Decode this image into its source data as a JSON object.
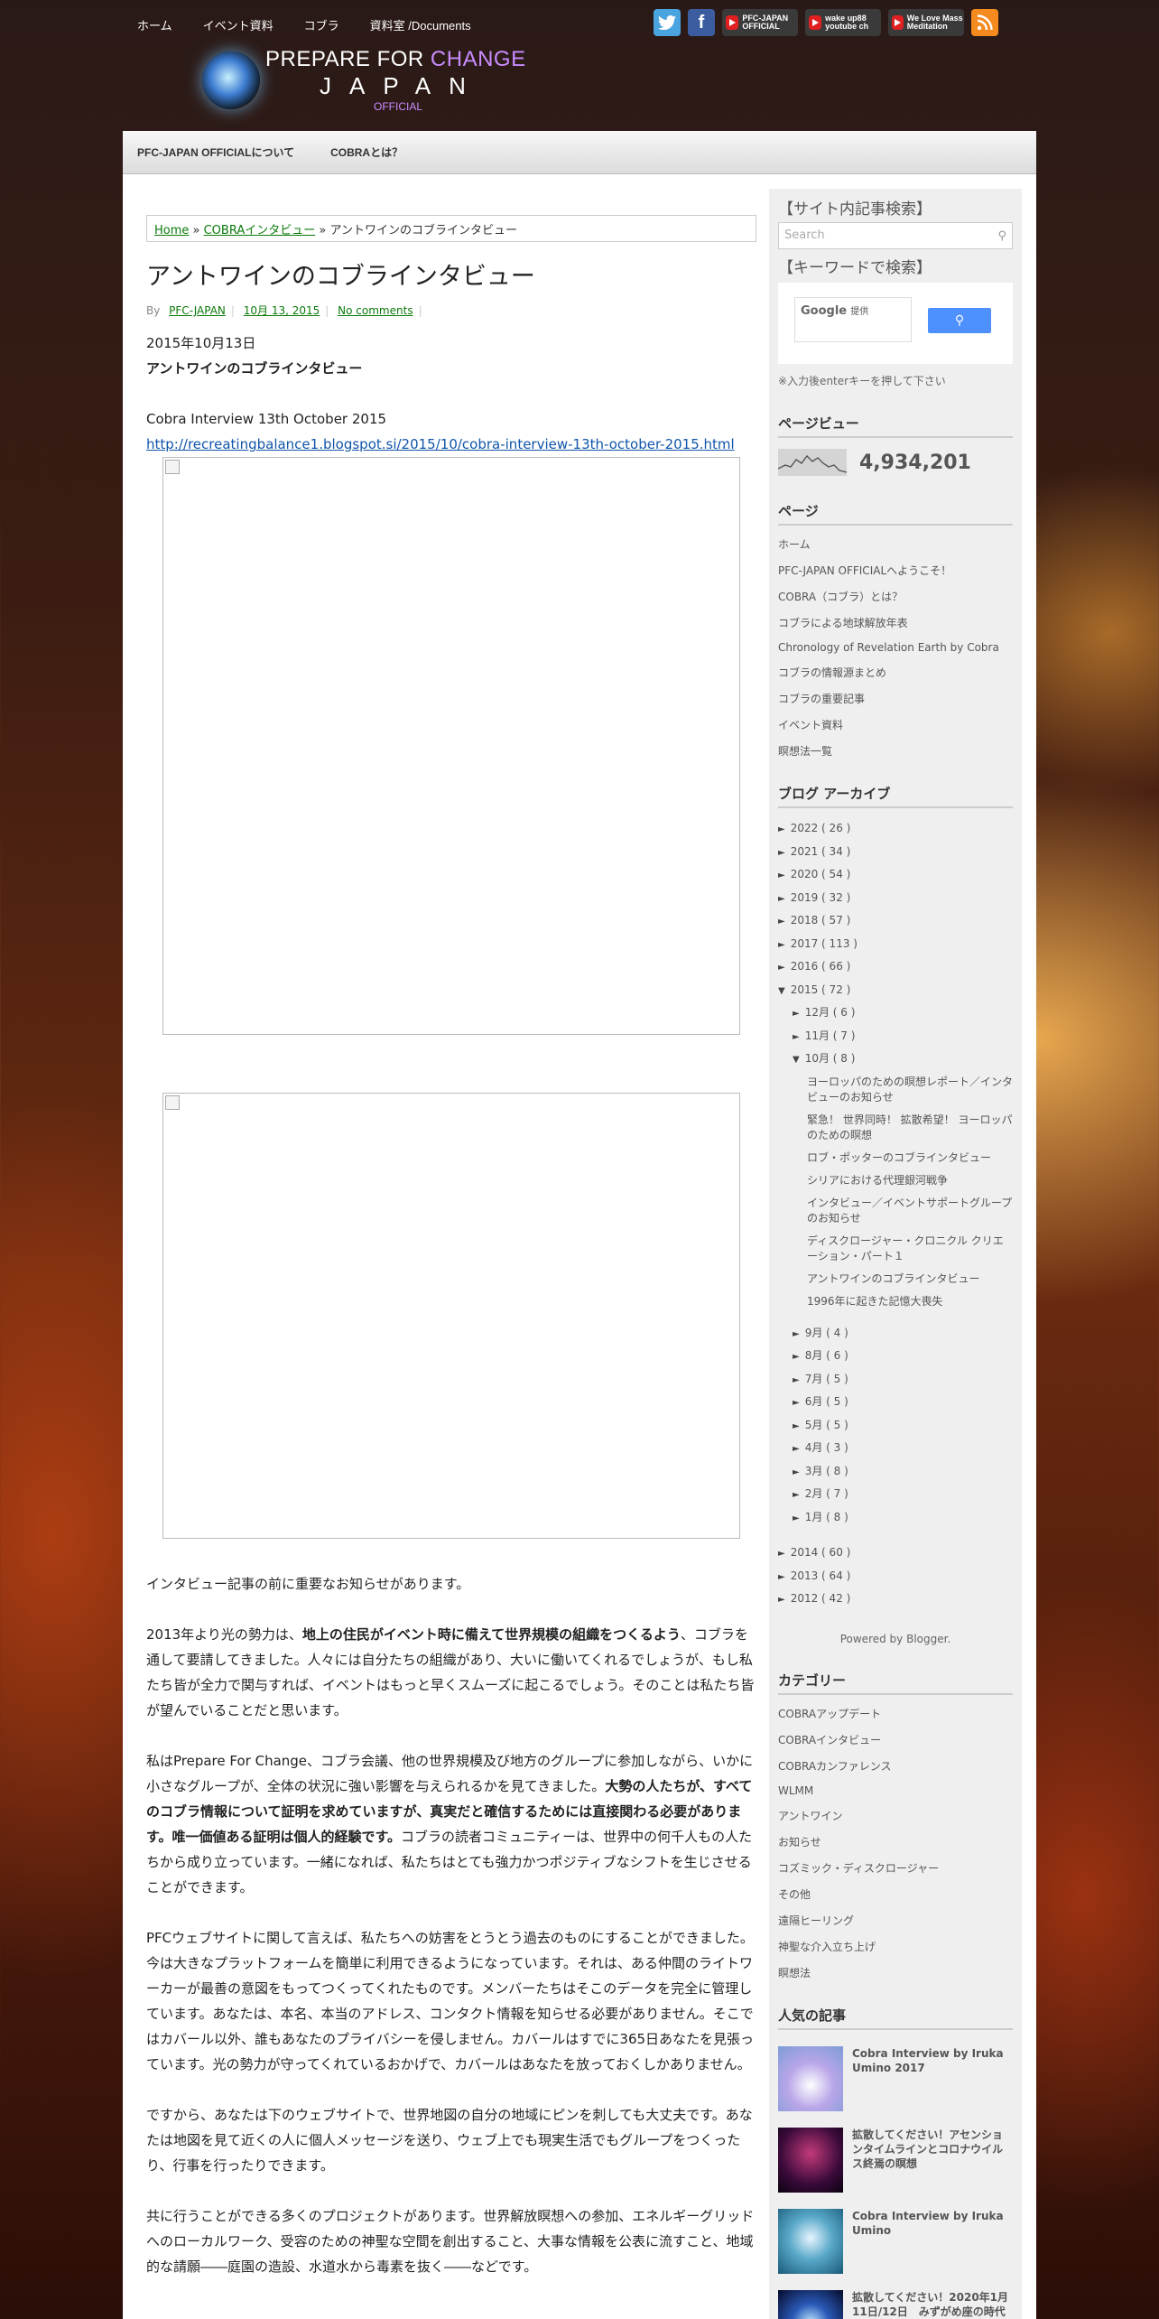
{
  "topnav": [
    "ホーム",
    "イベント資料",
    "コブラ",
    "資料室 /Documents"
  ],
  "social": {
    "twitter_icon": "twitter-icon",
    "facebook_icon": "facebook-icon",
    "yt1": "PFC-JAPAN OFFICIAL",
    "yt2": "wake up88 youtube ch",
    "yt3": "We Love Mass Meditation",
    "rss_icon": "rss-icon"
  },
  "logo": {
    "line1a": "PREPARE FOR ",
    "line1b": "CHANGE",
    "line2": "JAPAN",
    "line3": "OFFICIAL"
  },
  "menubar": [
    "PFC-JAPAN OFFICIALについて",
    "COBRAとは？"
  ],
  "breadcrumb": {
    "home": "Home",
    "sep1": " » ",
    "cat": "COBRAインタビュー",
    "sep2": " » ",
    "current": "アントワインのコブラインタビュー"
  },
  "post": {
    "title": "アントワインのコブラインタビュー",
    "by": "By",
    "author": "PFC-JAPAN",
    "date": "10月 13, 2015",
    "comments": "No comments",
    "date_line": "2015年10月13日",
    "subtitle": "アントワインのコブラインタビュー",
    "interview_title": "Cobra Interview 13th October 2015",
    "link": "http://recreatingbalance1.blogspot.si/2015/10/cobra-interview-13th-october-2015.html",
    "p1": "インタビュー記事の前に重要なお知らせがあります。",
    "p2a": "2013年より光の勢力は、",
    "p2b": "地上の住民がイベント時に備えて世界規模の組織をつくるよう",
    "p2c": "、コブラを通して要請してきました。人々には自分たちの組織があり、大いに働いてくれるでしょうが、もし私たち皆が全力で関与すれば、イベントはもっと早くスムーズに起こるでしょう。そのことは私たち皆が望んでいることだと思います。",
    "p3a": "私はPrepare For Change、コブラ会議、他の世界規模及び地方のグループに参加しながら、いかに小さなグループが、全体の状況に強い影響を与えられるかを見てきました。",
    "p3b": "大勢の人たちが、すべてのコブラ情報について証明を求めていますが、真実だと確信するためには直接関わる必要があります。唯一価値ある証明は個人的経験です。",
    "p3c": "コブラの読者コミュニティーは、世界中の何千人もの人たちから成り立っています。一緒になれば、私たちはとても強力かつポジティブなシフトを生じさせることができます。",
    "p4": "PFCウェブサイトに関して言えば、私たちへの妨害をとうとう過去のものにすることができました。今は大きなプラットフォームを簡単に利用できるようになっています。それは、ある仲間のライトワーカーが最善の意図をもってつくってくれたものです。メンバーたちはそこのデータを完全に管理しています。あなたは、本名、本当のアドレス、コンタクト情報を知らせる必要がありません。そこではカバール以外、誰もあなたのプライバシーを侵しません。カバールはすでに365日あなたを見張っています。光の勢力が守ってくれているおかげで、カバールはあなたを放っておくしかありません。",
    "p5": "ですから、あなたは下のウェブサイトで、世界地図の自分の地域にピンを刺しても大丈夫です。あなたは地図を見て近くの人に個人メッセージを送り、ウェブ上でも現実生活でもグループをつくったり、行事を行ったりできます。",
    "p6": "共に行うことができる多くのプロジェクトがあります。世界解放瞑想への参加、エネルギーグリッドへのローカルワーク、受容のための神聖な空間を創出すること、大事な情報を公表に流すこと、地域的な請願――庭園の造設、水道水から毒素を抜く――などです。"
  },
  "sidebar": {
    "search_title": "【サイト内記事検索】",
    "search_placeholder": "Search",
    "keyword_title": "【キーワードで検索】",
    "google_label": "Google",
    "google_sub": "提供",
    "note": "※入力後enterキーを押して下さい",
    "pageview_title": "ページビュー",
    "pageview_count": "4,934,201",
    "pages_title": "ページ",
    "pages": [
      "ホーム",
      "PFC-JAPAN OFFICIALへようこそ！",
      "COBRA（コブラ）とは？",
      "コブラによる地球解放年表",
      "Chronology of Revelation Earth by Cobra",
      "コブラの情報源まとめ",
      "コブラの重要記事",
      "イベント資料",
      "瞑想法一覧"
    ],
    "archive_title": "ブログ アーカイブ",
    "archive_top": [
      "2022 ( 26 )",
      "2021 ( 34 )",
      "2020 ( 54 )",
      "2019 ( 32 )",
      "2018 ( 57 )",
      "2017 ( 113 )",
      "2016 ( 66 )"
    ],
    "archive_2015": "2015 ( 72 )",
    "archive_2015_months_a": [
      "12月 ( 6 )",
      "11月 ( 7 )"
    ],
    "archive_oct": "10月 ( 8 )",
    "oct_posts": [
      "ヨーロッパのための瞑想レポート／インタビューのお知らせ",
      "緊急！ 世界同時！ 拡散希望！ ヨーロッパのための瞑想",
      "ロブ・ポッターのコブラインタビュー",
      "シリアにおける代理銀河戦争",
      "インタビュー／イベントサポートグループのお知らせ",
      "ディスクロージャー・クロニクル クリエーション・パート１",
      "アントワインのコブラインタビュー",
      "1996年に起きた記憶大喪失"
    ],
    "archive_2015_months_b": [
      "9月 ( 4 )",
      "8月 ( 6 )",
      "7月 ( 5 )",
      "6月 ( 5 )",
      "5月 ( 5 )",
      "4月 ( 3 )",
      "3月 ( 8 )",
      "2月 ( 7 )",
      "1月 ( 8 )"
    ],
    "archive_bottom": [
      "2014 ( 60 )",
      "2013 ( 64 )",
      "2012 ( 42 )"
    ],
    "powered": "Powered by Blogger.",
    "cat_title": "カテゴリー",
    "cats": [
      "COBRAアップデート",
      "COBRAインタビュー",
      "COBRAカンファレンス",
      "WLMM",
      "アントワイン",
      "お知らせ",
      "コズミック・ディスクロージャー",
      "その他",
      "遠隔ヒーリング",
      "神聖な介入立ち上げ",
      "瞑想法"
    ],
    "popular_title": "人気の記事",
    "popular": [
      "Cobra Interview by Iruka Umino 2017",
      "拡散してください！アセンションタイムラインとコロナウイルス終焉の瞑想",
      "Cobra Interview by Iruka Umino",
      "拡散してください！2020年1月11日/12日　みずがめ座の時代"
    ]
  },
  "colors": {
    "link_green": "#0a7a0a",
    "search_button": "#4d90fe",
    "rss": "#f58a1f",
    "twitter": "#4aa4e0",
    "facebook": "#3b5d9f",
    "youtube": "#e02020"
  }
}
